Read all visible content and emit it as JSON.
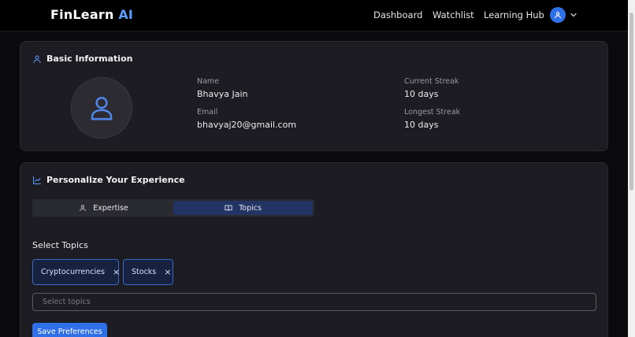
{
  "brand": {
    "name": "FinLearn",
    "accent": "AI"
  },
  "nav": {
    "dashboard": "Dashboard",
    "watchlist": "Watchlist",
    "learning_hub": "Learning Hub"
  },
  "basic_info": {
    "title": "Basic Information",
    "name_label": "Name",
    "name_value": "Bhavya Jain",
    "email_label": "Email",
    "email_value": "bhavyaj20@gmail.com",
    "current_streak_label": "Current Streak",
    "current_streak_value": "10 days",
    "longest_streak_label": "Longest Streak",
    "longest_streak_value": "10 days"
  },
  "personalize": {
    "title": "Personalize Your Experience",
    "tabs": [
      {
        "label": "Expertise",
        "icon": "user-icon",
        "active": false
      },
      {
        "label": "Topics",
        "icon": "book-icon",
        "active": true
      }
    ],
    "select_label": "Select Topics",
    "chips": [
      "Cryptocurrencies",
      "Stocks"
    ],
    "chip_remove": "×",
    "input_placeholder": "Select topics",
    "input_value": "",
    "save_label": "Save Preferences"
  },
  "colors": {
    "accent": "#2f6fe8",
    "brand_accent": "#5b9cff",
    "card_bg": "#1c1c22",
    "page_bg": "#0b0b0d",
    "chip_border": "#3b67c8"
  }
}
